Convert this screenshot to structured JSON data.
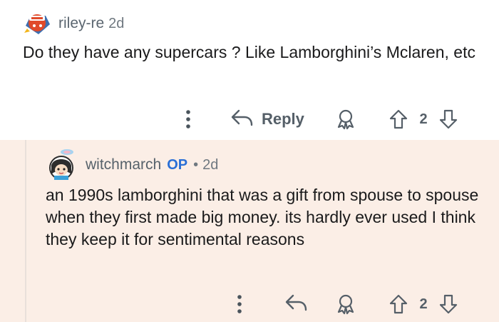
{
  "comment": {
    "author": "riley-re",
    "age": "2d",
    "body": "Do they have any supercars ? Like Lamborghini’s Mclaren, etc",
    "actions": {
      "more_icon": "more-vertical-icon",
      "reply_icon": "reply-arrow-icon",
      "reply_label": "Reply",
      "award_icon": "award-icon",
      "upvote_icon": "upvote-arrow-icon",
      "vote_count": "2",
      "downvote_icon": "downvote-arrow-icon"
    }
  },
  "reply": {
    "author": "witchmarch",
    "op_badge": "OP",
    "separator": "•",
    "age": "2d",
    "body": "an 1990s lamborghini that was a gift from spouse to spouse when they first made big money. its hardly ever used I think they keep it for sentimental reasons",
    "background_color": "#fbeee6",
    "op_color": "#2a6fd6",
    "actions": {
      "more_icon": "more-vertical-icon",
      "reply_icon": "reply-arrow-icon",
      "award_icon": "award-icon",
      "upvote_icon": "upvote-arrow-icon",
      "vote_count": "2",
      "downvote_icon": "downvote-arrow-icon"
    }
  }
}
